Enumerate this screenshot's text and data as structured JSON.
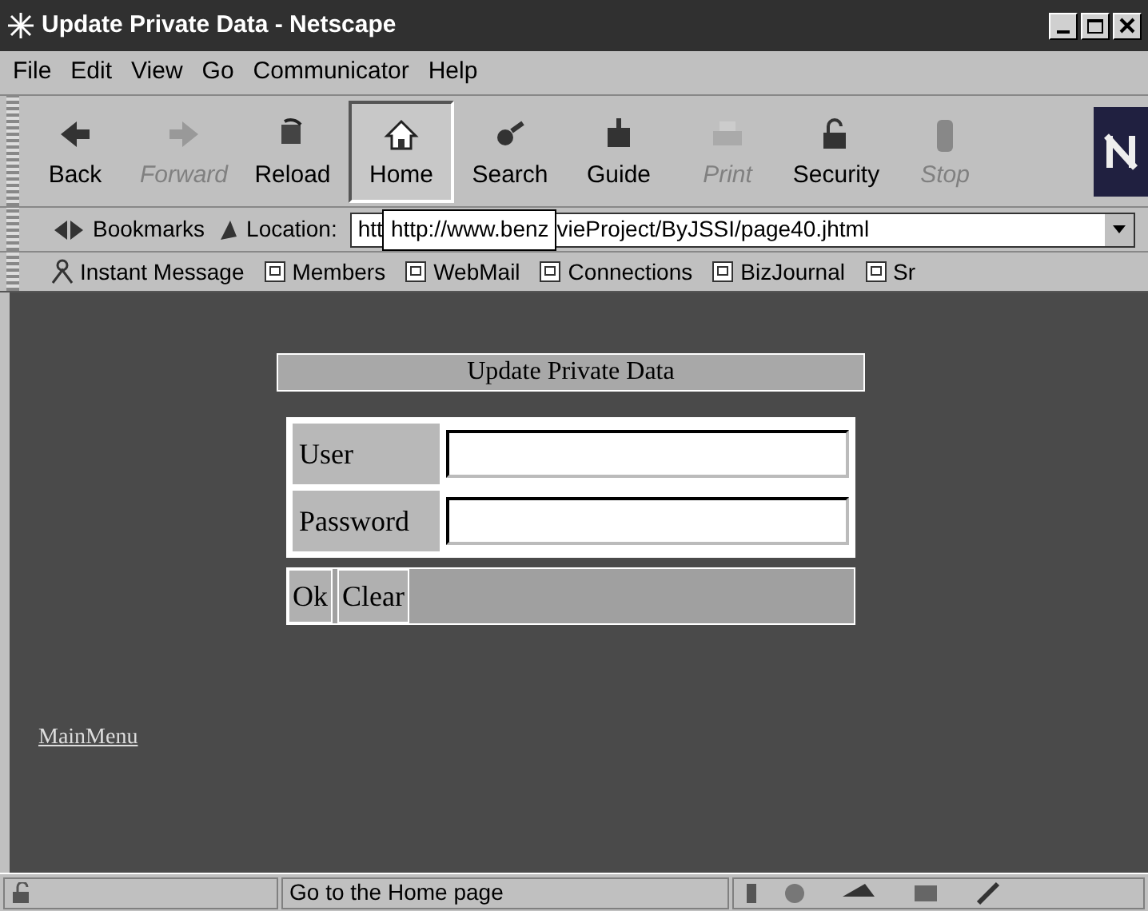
{
  "window": {
    "title": "Update Private Data - Netscape"
  },
  "menu": [
    "File",
    "Edit",
    "View",
    "Go",
    "Communicator",
    "Help"
  ],
  "toolbar": [
    {
      "label": "Back",
      "disabled": false,
      "selected": false
    },
    {
      "label": "Forward",
      "disabled": true,
      "selected": false
    },
    {
      "label": "Reload",
      "disabled": false,
      "selected": false
    },
    {
      "label": "Home",
      "disabled": false,
      "selected": true
    },
    {
      "label": "Search",
      "disabled": false,
      "selected": false
    },
    {
      "label": "Guide",
      "disabled": false,
      "selected": false
    },
    {
      "label": "Print",
      "disabled": true,
      "selected": false
    },
    {
      "label": "Security",
      "disabled": false,
      "selected": false
    },
    {
      "label": "Stop",
      "disabled": true,
      "selected": false
    }
  ],
  "location_bar": {
    "bookmarks": "Bookmarks",
    "label": "Location:",
    "value_start": "htt",
    "tooltip": "http://www.benz",
    "value_end": "vieProject/ByJSSI/page40.jhtml"
  },
  "personal_toolbar": [
    "Instant Message",
    "Members",
    "WebMail",
    "Connections",
    "BizJournal",
    "Sr"
  ],
  "form": {
    "heading": "Update Private Data",
    "fields": [
      {
        "label": "User"
      },
      {
        "label": "Password"
      }
    ],
    "buttons": [
      "Ok",
      "Clear"
    ]
  },
  "link": "MainMenu",
  "status_bar": {
    "message": "Go to the Home page"
  }
}
